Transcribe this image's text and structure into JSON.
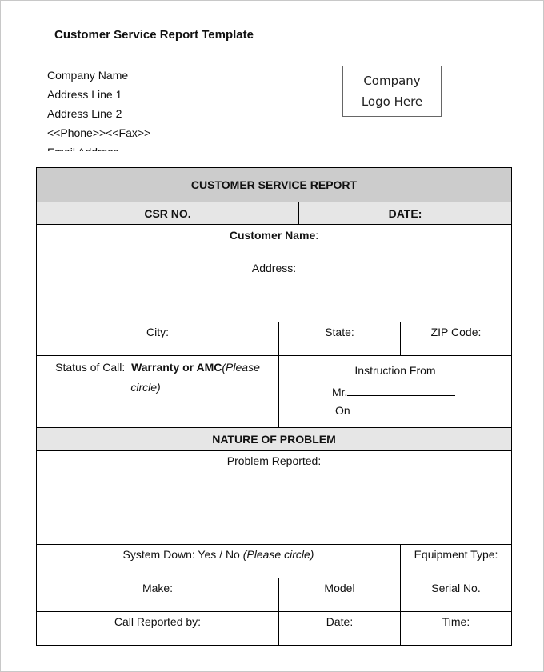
{
  "document": {
    "title": "Customer Service Report Template",
    "company": {
      "name": "Company Name",
      "address_line_1": "Address Line 1",
      "address_line_2": "Address Line 2",
      "phone_fax": "<<Phone>><<Fax>>",
      "email": "Email Address"
    },
    "logo_placeholder": {
      "line1": "Company",
      "line2": "Logo Here"
    }
  },
  "form": {
    "header": "CUSTOMER SERVICE REPORT",
    "csr_no": "CSR NO.",
    "date": "DATE:",
    "customer_name": "Customer Name",
    "customer_name_colon": ":",
    "address": "Address:",
    "city": "City:",
    "state": "State:",
    "zip": "ZIP Code:",
    "status_of_call": {
      "label": "Status of Call:",
      "options": "Warranty or AMC",
      "note_part1": "(Please",
      "note_part2": "circle)"
    },
    "instruction": {
      "label": "Instruction From",
      "mr": "Mr.",
      "on": "On"
    },
    "nature_header": "NATURE OF PROBLEM",
    "problem_reported": "Problem Reported:",
    "system_down": {
      "label": "System Down: Yes / No",
      "note": "(Please circle)"
    },
    "equipment_type": "Equipment Type:",
    "make": "Make:",
    "model": "Model",
    "serial_no": "Serial No.",
    "call_reported_by": "Call Reported by:",
    "date2": "Date:",
    "time": "Time:"
  }
}
